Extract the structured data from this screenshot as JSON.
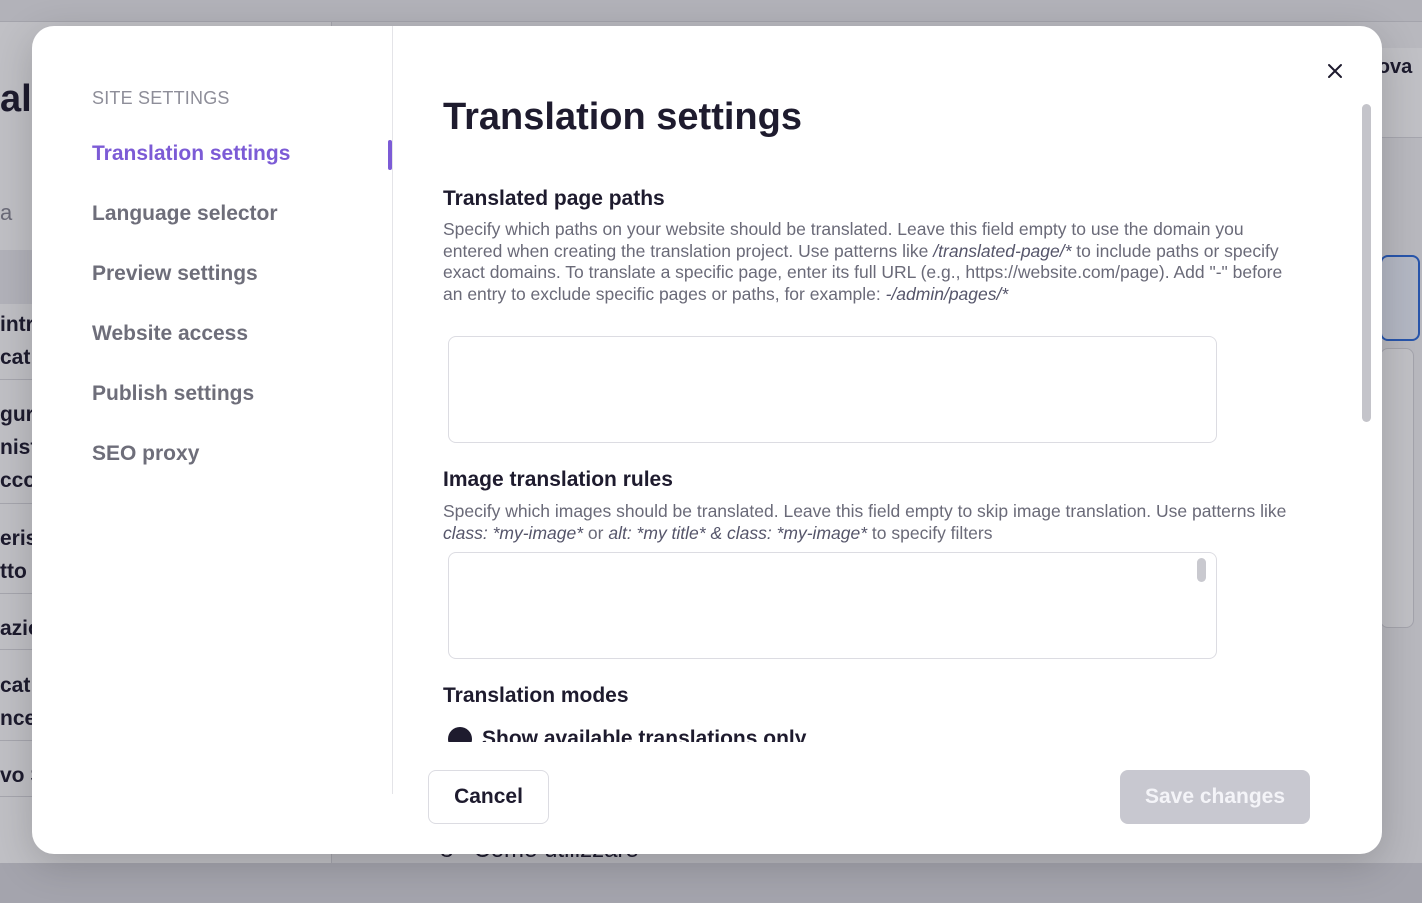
{
  "background": {
    "logo_partial": "al",
    "search_partial": "a",
    "row_fragments": [
      "intr",
      "cat",
      "gura",
      "nist",
      "cco",
      "eris",
      "tto",
      "azio",
      "cat",
      "nce",
      "vo S"
    ],
    "right_button_partial": "rova",
    "bottom_row_number": "8",
    "bottom_row_text": "Come utilizzare"
  },
  "sidebar": {
    "heading": "SITE SETTINGS",
    "items": [
      {
        "label": "Translation settings",
        "active": true
      },
      {
        "label": "Language selector",
        "active": false
      },
      {
        "label": "Preview settings",
        "active": false
      },
      {
        "label": "Website access",
        "active": false
      },
      {
        "label": "Publish settings",
        "active": false
      },
      {
        "label": "SEO proxy",
        "active": false
      }
    ]
  },
  "content": {
    "title": "Translation settings",
    "page_paths": {
      "title": "Translated page paths",
      "desc_1": "Specify which paths on your website should be translated. Leave this field empty to use the domain you entered when creating the translation project. Use patterns like ",
      "desc_em_1": "/translated-page/*",
      "desc_2": " to include paths or specify exact domains. To translate a specific page, enter its full URL (e.g., https://website.com/page). Add \"-\" before an entry to exclude specific pages or paths, for example: ",
      "desc_em_2": "-/admin/pages/*",
      "value": ""
    },
    "image_rules": {
      "title": "Image translation rules",
      "desc_1": "Specify which images should be translated. Leave this field empty to skip image translation. Use patterns like ",
      "desc_em_1": "class: *my-image*",
      "desc_2": " or ",
      "desc_em_2": "alt: *my title* & class: *my-image*",
      "desc_3": " to specify filters",
      "value": ""
    },
    "modes": {
      "title": "Translation modes",
      "option_1": "Show available translations only"
    }
  },
  "footer": {
    "cancel_label": "Cancel",
    "save_label": "Save changes"
  },
  "colors": {
    "accent": "#7c5bd6",
    "text": "#1e1b2e",
    "muted": "#6e6e7a",
    "disabled_button": "#c8c8d0"
  },
  "icons": {
    "close": "close-icon"
  }
}
